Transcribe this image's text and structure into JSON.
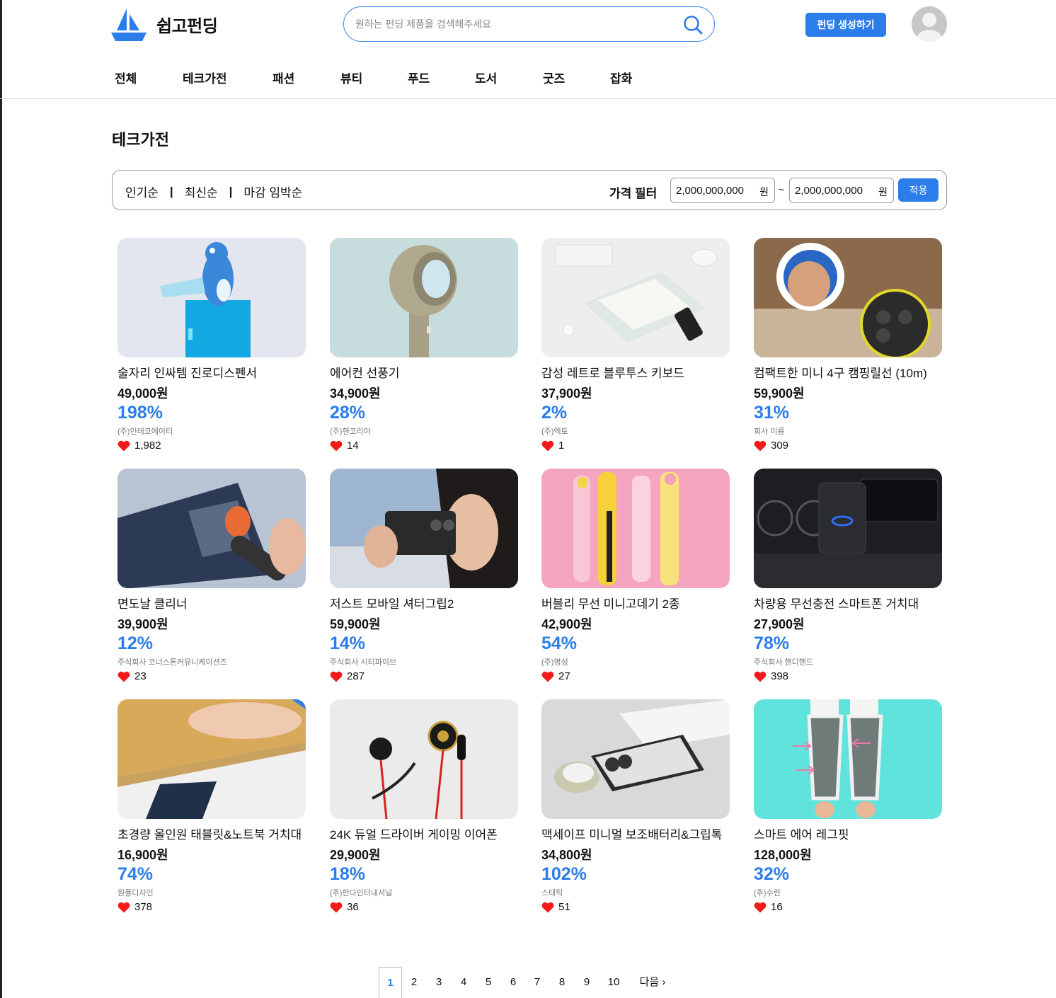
{
  "brand": {
    "name": "쉽고펀딩",
    "accent": "#2b7de9"
  },
  "search": {
    "placeholder": "원하는 펀딩 제품을 검색해주세요"
  },
  "header": {
    "create_label": "펀딩 생성하기"
  },
  "nav": [
    "전체",
    "테크가전",
    "패션",
    "뷰티",
    "푸드",
    "도서",
    "굿즈",
    "잡화"
  ],
  "section_title": "테크가전",
  "filter": {
    "sort": [
      "인기순",
      "최신순",
      "마감 임박순"
    ],
    "price_label": "가격 필터",
    "min": "2,000,000,000",
    "max": "2,000,000,000",
    "unit": "원",
    "tilde": "~",
    "apply_label": "적용"
  },
  "products": [
    {
      "title": "술자리 인싸템 진로디스펜서",
      "price": "49,000원",
      "percent": "198%",
      "company": "(주)인테코에이티",
      "likes": "1,982",
      "image": "blue-toad-dispenser"
    },
    {
      "title": "에어컨 선풍기",
      "price": "34,900원",
      "percent": "28%",
      "company": "(주)헨코리아",
      "likes": "14",
      "image": "handheld-fan"
    },
    {
      "title": "감성 레트로 블루투스 키보드",
      "price": "37,900원",
      "percent": "2%",
      "company": "(주)엑토",
      "likes": "1",
      "image": "retro-keyboard"
    },
    {
      "title": "컴팩트한 미니 4구 캠핑릴선 (10m)",
      "price": "59,900원",
      "percent": "31%",
      "company": "회사 이름",
      "likes": "309",
      "image": "cable-reel"
    },
    {
      "title": "면도날 클리너",
      "price": "39,900원",
      "percent": "12%",
      "company": "주식회사 코너스톤커뮤니케이션즈",
      "likes": "23",
      "image": "razor-cleaner"
    },
    {
      "title": "저스트 모바일 셔터그립2",
      "price": "59,900원",
      "percent": "14%",
      "company": "주식회사 시티파이브",
      "likes": "287",
      "image": "shutter-grip"
    },
    {
      "title": "버블리 무선 미니고데기 2종",
      "price": "42,900원",
      "percent": "54%",
      "company": "(주)명성",
      "likes": "27",
      "image": "mini-hair-iron"
    },
    {
      "title": "차량용 무선충전 스마트폰 거치대",
      "price": "27,900원",
      "percent": "78%",
      "company": "주식회사 핸디핸드",
      "likes": "398",
      "image": "car-phone-mount"
    },
    {
      "title": "초경량 올인원 태블릿&노트북 거치대",
      "price": "16,900원",
      "percent": "74%",
      "company": "원플디자인",
      "likes": "378",
      "image": "laptop-stand"
    },
    {
      "title": "24K 듀얼 드라이버 게이밍 이어폰",
      "price": "29,900원",
      "percent": "18%",
      "company": "(주)판다인터내셔널",
      "likes": "36",
      "image": "gaming-earphones"
    },
    {
      "title": "맥세이프 미니멀 보조배터리&그립톡",
      "price": "34,800원",
      "percent": "102%",
      "company": "스태틱",
      "likes": "51",
      "image": "magsafe-battery"
    },
    {
      "title": "스마트 에어 레그핏",
      "price": "128,000원",
      "percent": "32%",
      "company": "(주)수련",
      "likes": "16",
      "image": "leg-massager"
    }
  ],
  "pagination": {
    "pages": [
      "1",
      "2",
      "3",
      "4",
      "5",
      "6",
      "7",
      "8",
      "9",
      "10"
    ],
    "current": "1",
    "next_label": "다음 ›"
  }
}
